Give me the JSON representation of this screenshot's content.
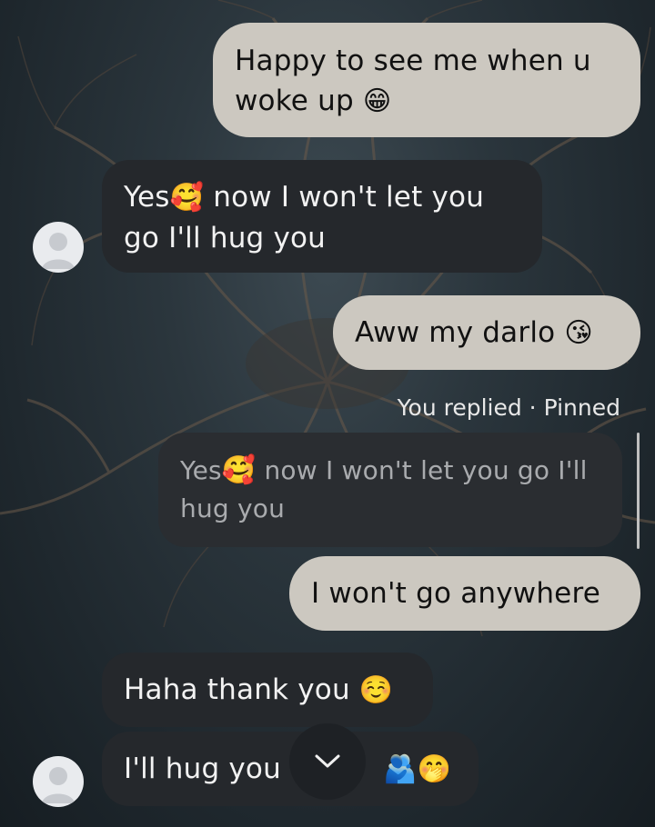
{
  "messages": [
    {
      "from": "me",
      "text": "Happy to see me when u woke up",
      "emoji": "😁"
    },
    {
      "from": "them",
      "text_a": "Yes",
      "emoji": "🥰",
      "text_b": " now I won't let you go I'll hug you"
    },
    {
      "from": "me",
      "text": "Aww my darlo",
      "emoji": "😘"
    },
    {
      "reply_meta": "You replied · Pinned",
      "quoted": {
        "text_a": "Yes",
        "emoji": "🥰",
        "text_b": " now I won't let you go I'll hug you"
      },
      "reply": {
        "from": "me",
        "text": "I won't go anywhere"
      }
    },
    {
      "from": "them",
      "text": "Haha thank you",
      "emoji": "☺️"
    },
    {
      "from": "them",
      "text": "I'll hug you",
      "emoji": "🫂🤭"
    }
  ],
  "scroll_button": {
    "icon": "chevron-down-icon"
  },
  "colors": {
    "outgoing": "#ccc8c0",
    "incoming": "#25282c",
    "quoted": "#2a2d31"
  }
}
